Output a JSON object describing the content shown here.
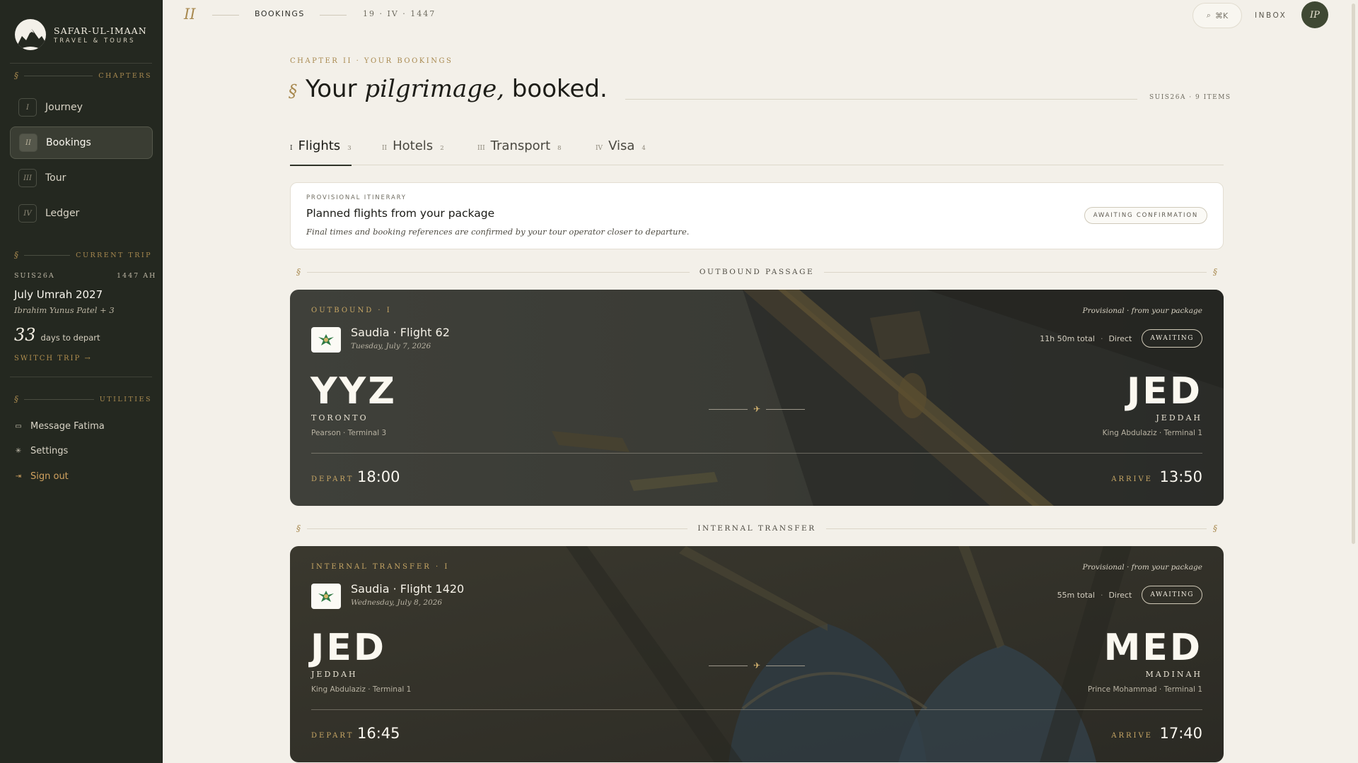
{
  "brand": {
    "name": "SAFAR-UL-IMAAN",
    "sub": "TRAVEL & TOURS"
  },
  "sidebar": {
    "chapters_label": "CHAPTERS",
    "nav": [
      {
        "num": "I",
        "label": "Journey"
      },
      {
        "num": "II",
        "label": "Bookings"
      },
      {
        "num": "III",
        "label": "Tour"
      },
      {
        "num": "IV",
        "label": "Ledger"
      }
    ],
    "current_trip_label": "CURRENT TRIP",
    "trip": {
      "code": "SUIS26A",
      "year": "1447 AH",
      "name": "July Umrah 2027",
      "people": "Ibrahim Yunus Patel + 3",
      "days": "33",
      "days_text": "days to depart",
      "switch": "SWITCH TRIP →"
    },
    "utilities_label": "UTILITIES",
    "utilities": [
      {
        "icon": "chat-icon",
        "label": "Message Fatima"
      },
      {
        "icon": "gear-icon",
        "label": "Settings"
      },
      {
        "icon": "sign-out-icon",
        "label": "Sign out"
      }
    ],
    "section_symbol": "§"
  },
  "topbar": {
    "crumb_num": "II",
    "crumb_label": "BOOKINGS",
    "date": "19 · IV · 1447",
    "search_symbol": "⌕",
    "search_shortcut": "⌘K",
    "inbox": "INBOX",
    "avatar": "IP"
  },
  "page": {
    "eyebrow": "CHAPTER II · YOUR BOOKINGS",
    "title_symbol": "§",
    "title_pre": "Your ",
    "title_ital": "pilgrimage,",
    "title_post": " booked.",
    "meta": "SUIS26A · 9 ITEMS"
  },
  "tabs": [
    {
      "num": "I",
      "label": "Flights",
      "count": "3"
    },
    {
      "num": "II",
      "label": "Hotels",
      "count": "2"
    },
    {
      "num": "III",
      "label": "Transport",
      "count": "8"
    },
    {
      "num": "IV",
      "label": "Visa",
      "count": "4"
    }
  ],
  "notice": {
    "kicker": "PROVISIONAL ITINERARY",
    "title": "Planned flights from your package",
    "desc": "Final times and booking references are confirmed by your tour operator closer to departure.",
    "badge": "AWAITING CONFIRMATION"
  },
  "dividers": {
    "outbound": "OUTBOUND PASSAGE",
    "internal": "INTERNAL TRANSFER",
    "symbol": "§"
  },
  "flights": [
    {
      "kicker": "OUTBOUND · I",
      "prov": "Provisional · from your package",
      "airline": "Saudia · Flight 62",
      "date": "Tuesday, July 7, 2026",
      "duration": "11h 50m total",
      "type": "Direct",
      "status": "AWAITING",
      "from_code": "YYZ",
      "from_city": "TORONTO",
      "from_term": "Pearson · Terminal 3",
      "to_code": "JED",
      "to_city": "JEDDAH",
      "to_term": "King Abdulaziz · Terminal 1",
      "plane": "✈",
      "depart_label": "DEPART",
      "depart": "18:00",
      "arrive_label": "ARRIVE",
      "arrive": "13:50"
    },
    {
      "kicker": "INTERNAL TRANSFER · I",
      "prov": "Provisional · from your package",
      "airline": "Saudia · Flight 1420",
      "date": "Wednesday, July 8, 2026",
      "duration": "55m total",
      "type": "Direct",
      "status": "AWAITING",
      "from_code": "JED",
      "from_city": "JEDDAH",
      "from_term": "King Abdulaziz · Terminal 1",
      "to_code": "MED",
      "to_city": "MADINAH",
      "to_term": "Prince Mohammad · Terminal 1",
      "plane": "✈",
      "depart_label": "DEPART",
      "depart": "16:45",
      "arrive_label": "ARRIVE",
      "arrive": "17:40"
    }
  ],
  "colors": {
    "sidebar_bg": "#242820",
    "page_bg": "#f3f0e9",
    "accent_gold": "#a8894f",
    "card_dark": "#3a3b34"
  }
}
